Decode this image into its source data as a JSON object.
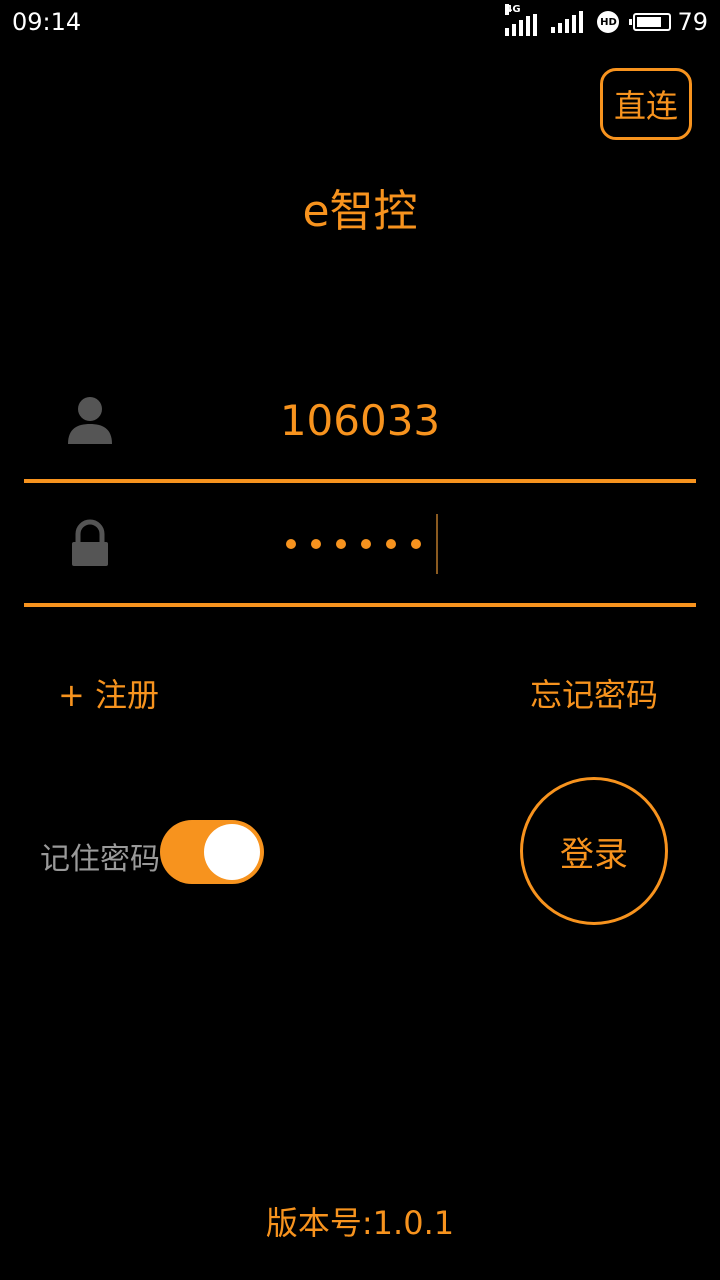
{
  "status_bar": {
    "time": "09:14",
    "network_tag": "4G",
    "hd_label": "HD",
    "battery_percent": "79",
    "battery_level": 0.79
  },
  "header": {
    "direct_connect_label": "直连",
    "app_title": "e智控"
  },
  "login_form": {
    "username_value": "106033",
    "password_length": 6,
    "register_label": "+ 注册",
    "forgot_password_label": "忘记密码",
    "remember_password_label": "记住密码",
    "remember_password_on": true,
    "login_label": "登录"
  },
  "footer": {
    "version_text": "版本号:1.0.1"
  },
  "colors": {
    "accent": "#f7931e",
    "background": "#000000",
    "icon_gray": "#555555",
    "label_gray": "#9a9a9a"
  },
  "icons": {
    "username": "user-icon",
    "password": "lock-icon"
  }
}
